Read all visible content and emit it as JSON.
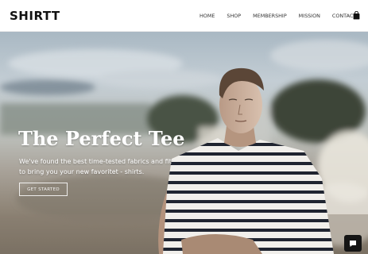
{
  "header": {
    "logo": "SHIRTT",
    "nav": [
      {
        "label": "HOME"
      },
      {
        "label": "SHOP"
      },
      {
        "label": "MEMBERSHIP"
      },
      {
        "label": "MISSION"
      },
      {
        "label": "CONTACT"
      }
    ],
    "cart_icon": "shopping-bag-icon"
  },
  "hero": {
    "title": "The Perfect Tee",
    "subtitle_line1": "We've found the best  time-tested fabrics and fit",
    "subtitle_line2": "to bring you your new favoritet - shirts.",
    "cta_label": "GET STARTED"
  },
  "chat": {
    "icon": "chat-bubble-icon"
  },
  "colors": {
    "accent_dark": "#111111",
    "nav_text": "#333333",
    "hero_text": "#ffffff"
  }
}
